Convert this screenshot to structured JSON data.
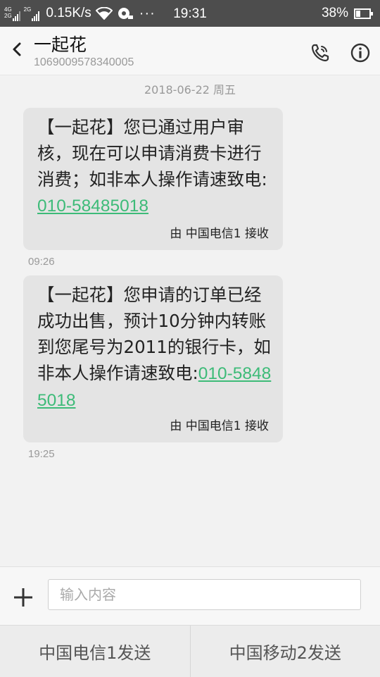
{
  "status_bar": {
    "sim1_label_top": "4G",
    "sim1_label_bottom": "2G",
    "sim2_label": "2G",
    "network_speed": "0.15K/s",
    "more_dots": "···",
    "time": "19:31",
    "battery_percent": "38%",
    "battery_level": 0.38
  },
  "header": {
    "contact_name": "一起花",
    "contact_number": "1069009578340005",
    "icons": [
      "back-arrow-icon",
      "phone-call-icon",
      "info-icon"
    ]
  },
  "conversation": {
    "date": "2018-06-22 周五",
    "messages": [
      {
        "text_before": "【一起花】您已通过用户审核，现在可以申请消费卡进行消费；如非本人操作请速致电:",
        "phone": "010-58485018",
        "received_via": "由 中国电信1 接收",
        "time": "09:26"
      },
      {
        "text_before": "【一起花】您申请的订单已经成功出售，预计10分钟内转账到您尾号为2011的银行卡，如非本人操作请速致电:",
        "phone": "010-58485018",
        "received_via": "由 中国电信1 接收",
        "time": "19:25"
      }
    ]
  },
  "compose": {
    "placeholder": "输入内容",
    "value": ""
  },
  "send_buttons": {
    "sim1": "中国电信1发送",
    "sim2": "中国移动2发送"
  },
  "colors": {
    "status_bar_bg": "#4d4d4d",
    "bubble_bg": "#e4e4e4",
    "link": "#3dbb78"
  }
}
